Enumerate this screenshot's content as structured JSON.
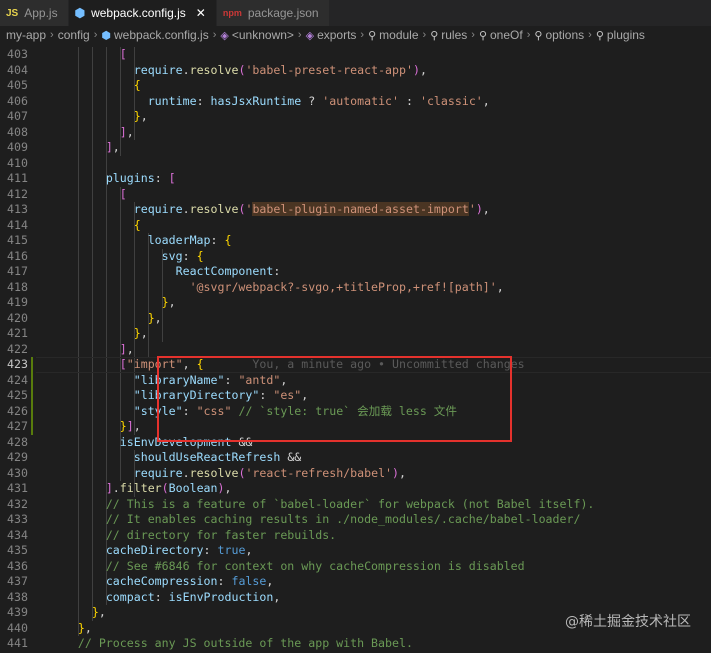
{
  "tabs": [
    {
      "icon": "JS",
      "label": "App.js",
      "active": false
    },
    {
      "icon": "gear",
      "label": "webpack.config.js",
      "active": true
    },
    {
      "icon": "npm",
      "label": "package.json",
      "active": false
    }
  ],
  "breadcrumb": [
    "my-app",
    "config",
    "webpack.config.js",
    "<unknown>",
    "exports",
    "module",
    "rules",
    "oneOf",
    "options",
    "plugins"
  ],
  "blame_text": "You, a minute ago • Uncommitted changes",
  "watermark": "@稀土掘金技术社区",
  "lines": [
    {
      "n": "403",
      "t": "            ["
    },
    {
      "n": "404",
      "t": "              require.resolve('babel-preset-react-app'),"
    },
    {
      "n": "405",
      "t": "              {"
    },
    {
      "n": "406",
      "t": "                runtime: hasJsxRuntime ? 'automatic' : 'classic',"
    },
    {
      "n": "407",
      "t": "              },"
    },
    {
      "n": "408",
      "t": "            ],"
    },
    {
      "n": "409",
      "t": "          ],"
    },
    {
      "n": "410",
      "t": ""
    },
    {
      "n": "411",
      "t": "          plugins: ["
    },
    {
      "n": "412",
      "t": "            ["
    },
    {
      "n": "413",
      "t": "              require.resolve('babel-plugin-named-asset-import'),"
    },
    {
      "n": "414",
      "t": "              {"
    },
    {
      "n": "415",
      "t": "                loaderMap: {"
    },
    {
      "n": "416",
      "t": "                  svg: {"
    },
    {
      "n": "417",
      "t": "                    ReactComponent:"
    },
    {
      "n": "418",
      "t": "                      '@svgr/webpack?-svgo,+titleProp,+ref![path]',"
    },
    {
      "n": "419",
      "t": "                  },"
    },
    {
      "n": "420",
      "t": "                },"
    },
    {
      "n": "421",
      "t": "              },"
    },
    {
      "n": "422",
      "t": "            ],"
    },
    {
      "n": "423",
      "t": "            [\"import\", {"
    },
    {
      "n": "424",
      "t": "              \"libraryName\": \"antd\","
    },
    {
      "n": "425",
      "t": "              \"libraryDirectory\": \"es\","
    },
    {
      "n": "426",
      "t": "              \"style\": \"css\" // `style: true` 会加载 less 文件"
    },
    {
      "n": "427",
      "t": "            }],"
    },
    {
      "n": "428",
      "t": "            isEnvDevelopment &&"
    },
    {
      "n": "429",
      "t": "              shouldUseReactRefresh &&"
    },
    {
      "n": "430",
      "t": "              require.resolve('react-refresh/babel'),"
    },
    {
      "n": "431",
      "t": "          ].filter(Boolean),"
    },
    {
      "n": "432",
      "t": "          // This is a feature of `babel-loader` for webpack (not Babel itself)."
    },
    {
      "n": "433",
      "t": "          // It enables caching results in ./node_modules/.cache/babel-loader/"
    },
    {
      "n": "434",
      "t": "          // directory for faster rebuilds."
    },
    {
      "n": "435",
      "t": "          cacheDirectory: true,"
    },
    {
      "n": "436",
      "t": "          // See #6846 for context on why cacheCompression is disabled"
    },
    {
      "n": "437",
      "t": "          cacheCompression: false,"
    },
    {
      "n": "438",
      "t": "          compact: isEnvProduction,"
    },
    {
      "n": "439",
      "t": "        },"
    },
    {
      "n": "440",
      "t": "      },"
    },
    {
      "n": "441",
      "t": "      // Process any JS outside of the app with Babel."
    }
  ]
}
